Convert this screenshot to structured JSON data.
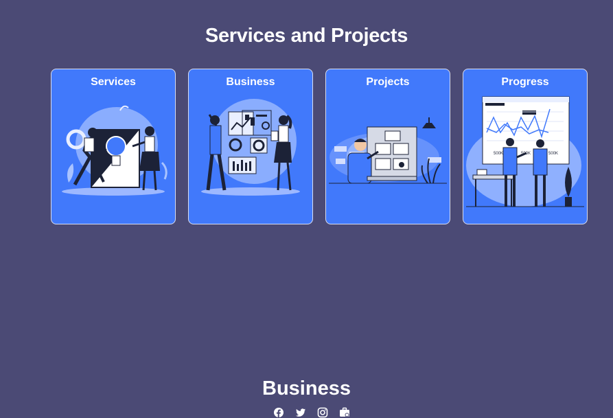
{
  "page": {
    "title": "Services and Projects"
  },
  "cards": [
    {
      "title": "Services",
      "illustration": "lightbulb-teamwork-illustration"
    },
    {
      "title": "Business",
      "illustration": "business-charts-illustration"
    },
    {
      "title": "Projects",
      "illustration": "project-board-illustration"
    },
    {
      "title": "Progress",
      "illustration": "progress-dashboard-illustration"
    }
  ],
  "footer": {
    "brand": "Business",
    "social": [
      "facebook-icon",
      "twitter-icon",
      "instagram-icon",
      "briefcase-icon"
    ]
  },
  "colors": {
    "background": "#4b4a75",
    "card": "#4179fb",
    "card_border": "#d7dcef",
    "text": "#ffffff"
  }
}
